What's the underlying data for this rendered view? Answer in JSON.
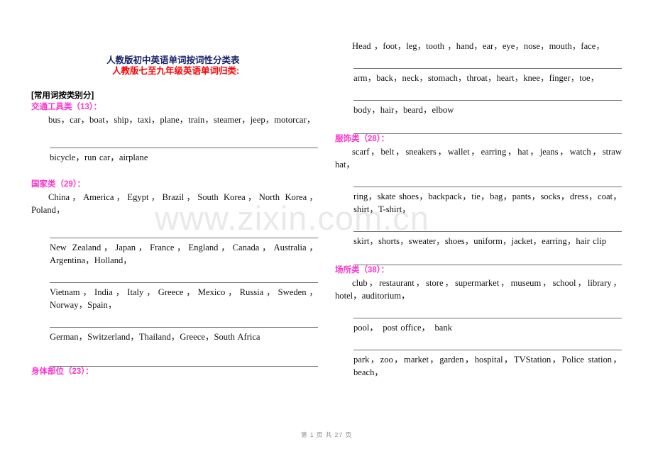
{
  "document": {
    "title": "人教版初中英语单词按词性分类表",
    "subtitle": "人教版七至九年级英语单词归类:",
    "section_tag": "[常用词按类别分]",
    "watermark": "www.zixin.com.cn",
    "footer": "第 1 页 共 27 页"
  },
  "colors": {
    "title": "#16216b",
    "subtitle": "#ff0000",
    "category_heading": "#ff33cc",
    "body_text": "#111111",
    "rule": "#6f6f6f",
    "watermark": "#e9e9e9",
    "footer": "#8a8a8a",
    "page_background": "#ffffff"
  },
  "left_column": {
    "categories": [
      {
        "heading": "交通工具类（13）：",
        "lead_words": "bus，car，boat，ship，taxi，plane，train，steamer，jeep，motorcar，",
        "blocks": [
          {
            "type": "gap",
            "size": "md"
          },
          {
            "type": "ruled",
            "words": "bicycle，run car，airplane"
          },
          {
            "type": "gap",
            "size": "md"
          }
        ]
      },
      {
        "heading": "国家类（29）：",
        "lead_words": "China，America，Egypt，Brazil，South Korea，North Korea，Poland，",
        "blocks": [
          {
            "type": "gap",
            "size": "md"
          },
          {
            "type": "ruled",
            "words": "New Zealand，Japan，France，England，Canada，Australia，Argentina，Holland，"
          },
          {
            "type": "gap",
            "size": "sm"
          },
          {
            "type": "ruled",
            "words": "Vietnam，India，Italy，Greece，Mexico，Russia，Sweden，Norway，Spain，"
          },
          {
            "type": "gap",
            "size": "sm"
          },
          {
            "type": "ruled",
            "words": "German，Switzerland，Thailand，Greece，South Africa"
          },
          {
            "type": "gap",
            "size": "md"
          },
          {
            "type": "rule"
          }
        ]
      },
      {
        "heading": "身体部位（23）：",
        "lead_words": "",
        "blocks": []
      }
    ]
  },
  "right_column": {
    "categories": [
      {
        "heading": "",
        "lead_words": "Head ，foot，leg，tooth ，hand，ear，eye，nose，mouth，face，",
        "blocks": [
          {
            "type": "gap",
            "size": "sm"
          },
          {
            "type": "ruled",
            "words": "arm，back，neck，stomach，throat，heart，knee，finger，toe，"
          },
          {
            "type": "gap",
            "size": "sm"
          },
          {
            "type": "ruled",
            "words": "body，hair，beard，elbow"
          },
          {
            "type": "gap",
            "size": "sm"
          },
          {
            "type": "rule"
          }
        ]
      },
      {
        "heading": "服饰类（28）：",
        "lead_words": "scarf，belt，sneakers，wallet，earring，hat，jeans，watch，straw hat，",
        "blocks": [
          {
            "type": "gap",
            "size": "sm"
          },
          {
            "type": "ruled",
            "words": "ring，skate shoes，backpack，tie，bag，pants，socks，dress，coat，shirt，T-shirt，"
          },
          {
            "type": "gap",
            "size": "sm"
          },
          {
            "type": "ruled",
            "words": "skirt，shorts，sweater，shoes，uniform，jacket，earring，hair clip"
          },
          {
            "type": "gap",
            "size": "sm"
          },
          {
            "type": "rule"
          }
        ]
      },
      {
        "heading": "场所类（38）：",
        "lead_words": "club，restaurant，store，supermarket，museum，school，library，hotel，auditorium，",
        "blocks": [
          {
            "type": "gap",
            "size": "sm"
          },
          {
            "type": "ruled",
            "words": "pool，　post office，　bank"
          },
          {
            "type": "gap",
            "size": "sm"
          },
          {
            "type": "ruled",
            "words": "park，zoo，market，garden，hospital，TVStation，Police station，beach，"
          }
        ]
      }
    ]
  }
}
